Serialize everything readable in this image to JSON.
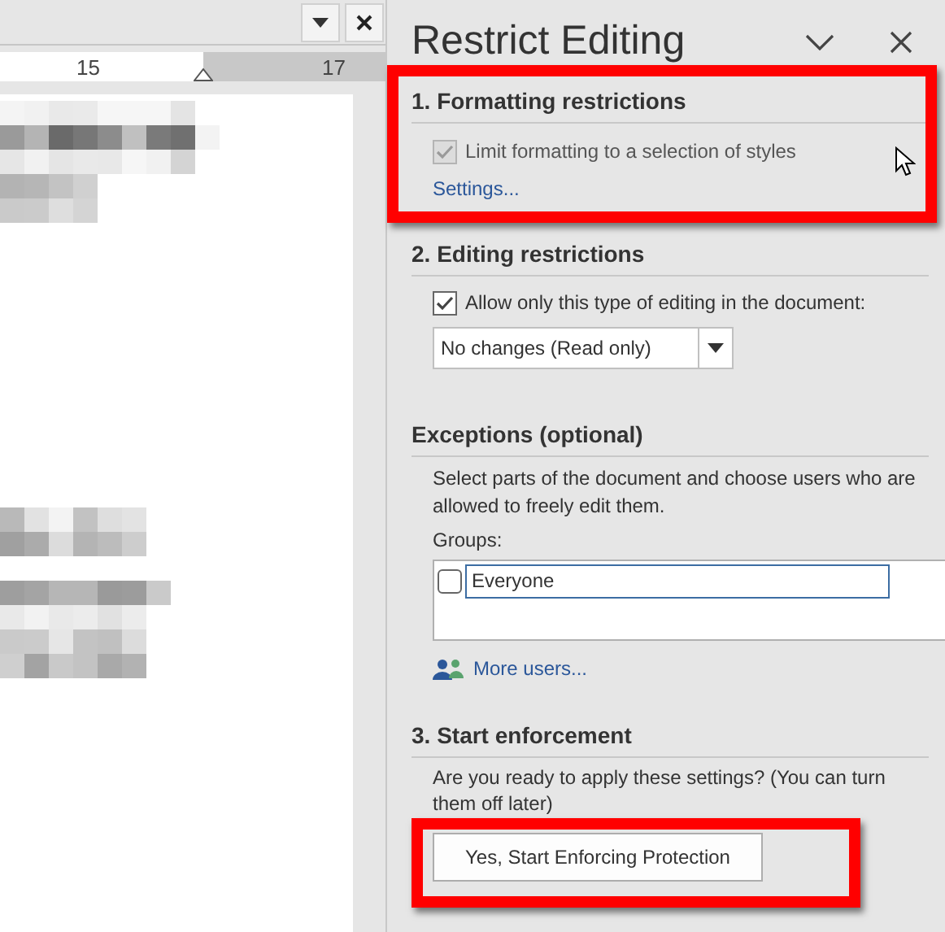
{
  "ruler": {
    "labels": [
      "15",
      "17"
    ]
  },
  "panel": {
    "title": "Restrict Editing"
  },
  "formatting": {
    "heading": "1. Formatting restrictions",
    "checkbox": {
      "label": "Limit formatting to a selection of styles",
      "checked": true,
      "disabled": true
    },
    "link": "Settings...",
    "highlighted": true
  },
  "editing": {
    "heading": "2. Editing restrictions",
    "checkbox": {
      "label": "Allow only this type of editing in the document:",
      "checked": true,
      "disabled": false
    },
    "dropdown": {
      "value": "No changes (Read only)"
    }
  },
  "exceptions": {
    "heading": "Exceptions (optional)",
    "description": "Select parts of the document and choose users who are allowed to freely edit them.",
    "groups_label": "Groups:",
    "groups": [
      {
        "name": "Everyone",
        "checked": false,
        "selected": true
      }
    ],
    "more_users": "More users..."
  },
  "enforcement": {
    "heading": "3. Start enforcement",
    "description": "Are you ready to apply these settings? (You can turn them off later)",
    "button": "Yes, Start Enforcing Protection",
    "highlighted": true
  }
}
